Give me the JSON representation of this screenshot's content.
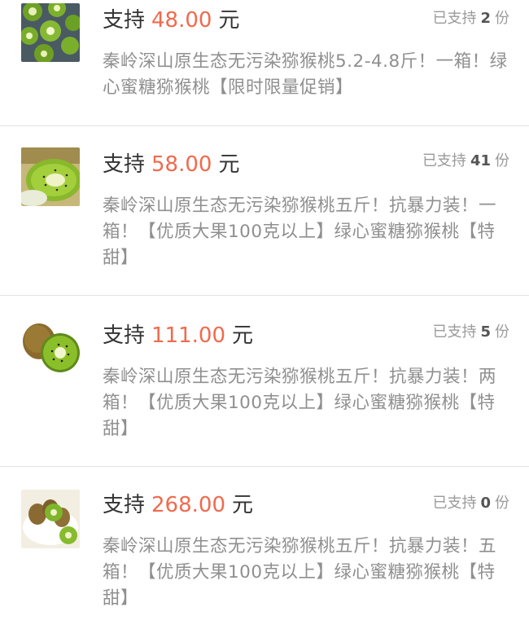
{
  "rewards": [
    {
      "support_prefix": "支持",
      "amount": "48.00",
      "currency": "元",
      "backers_prefix": "已支持",
      "backers_count": "2",
      "backers_suffix": "份",
      "description": "秦岭深山原生态无污染猕猴桃5.2-4.8斤！一箱！绿心蜜糖猕猴桃【限时限量促销】",
      "image_icon": "kiwi-plate-photo"
    },
    {
      "support_prefix": "支持",
      "amount": "58.00",
      "currency": "元",
      "backers_prefix": "已支持",
      "backers_count": "41",
      "backers_suffix": "份",
      "description": "秦岭深山原生态无污染猕猴桃五斤！抗暴力装！一箱！【优质大果100克以上】绿心蜜糖猕猴桃【特甜】",
      "image_icon": "kiwi-slice-photo"
    },
    {
      "support_prefix": "支持",
      "amount": "111.00",
      "currency": "元",
      "backers_prefix": "已支持",
      "backers_count": "5",
      "backers_suffix": "份",
      "description": "秦岭深山原生态无污染猕猴桃五斤！抗暴力装！两箱！【优质大果100克以上】绿心蜜糖猕猴桃【特甜】",
      "image_icon": "kiwi-half-photo"
    },
    {
      "support_prefix": "支持",
      "amount": "268.00",
      "currency": "元",
      "backers_prefix": "已支持",
      "backers_count": "0",
      "backers_suffix": "份",
      "description": "秦岭深山原生态无污染猕猴桃五斤！抗暴力装！五箱！【优质大果100克以上】绿心蜜糖猕猴桃【特甜】",
      "image_icon": "kiwi-bowl-photo"
    }
  ],
  "colors": {
    "amount": "#f06a4d",
    "description": "#8f8f8f",
    "divider": "#e3e3e3"
  }
}
